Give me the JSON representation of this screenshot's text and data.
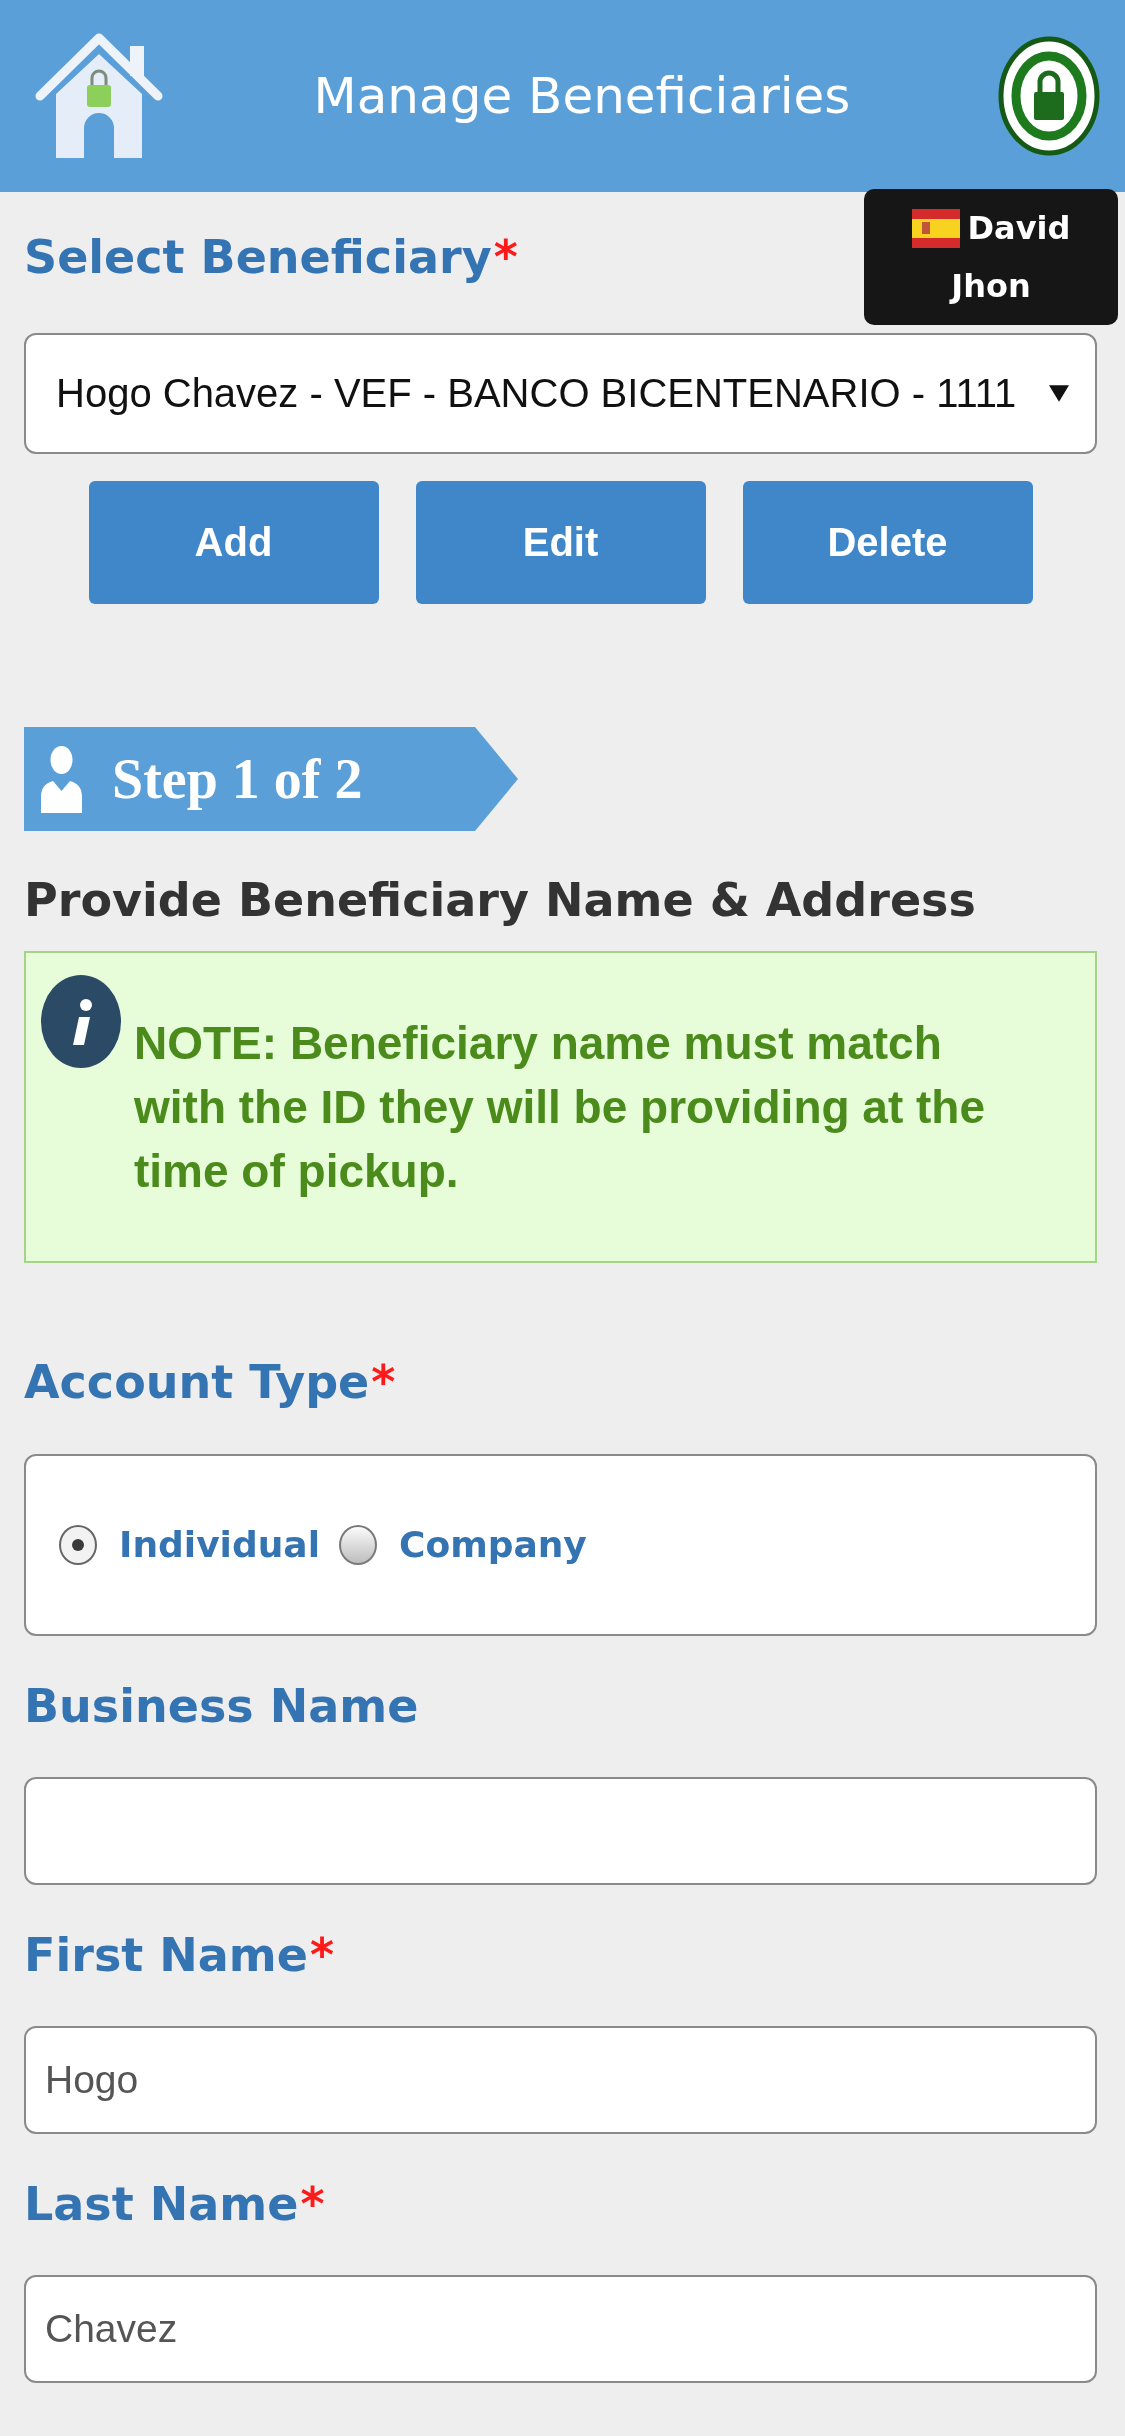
{
  "header": {
    "title": "Manage Beneficiaries"
  },
  "user_badge": {
    "name": "David Jhon"
  },
  "select_beneficiary": {
    "label": "Select Beneficiary",
    "required_mark": "*",
    "value": "Hogo Chavez - VEF - BANCO BICENTENARIO - 1111"
  },
  "actions": [
    {
      "label": "Add"
    },
    {
      "label": "Edit"
    },
    {
      "label": "Delete"
    }
  ],
  "step": {
    "label": "Step 1 of 2"
  },
  "section_title": "Provide Beneficiary Name & Address",
  "note": {
    "text": "NOTE: Beneficiary name must match with the ID they will be providing at the time of pickup."
  },
  "fields": [
    {
      "kind": "radio",
      "label": "Account Type",
      "required_mark": "*",
      "options": [
        {
          "label": "Individual",
          "selected": true
        },
        {
          "label": "Company",
          "selected": false
        }
      ]
    },
    {
      "kind": "text",
      "label": "Business Name"
    },
    {
      "kind": "text",
      "label": "First Name",
      "required_mark": "*",
      "value": "Hogo"
    },
    {
      "kind": "text",
      "label": "Last Name",
      "required_mark": "*",
      "value": "Chavez"
    }
  ]
}
